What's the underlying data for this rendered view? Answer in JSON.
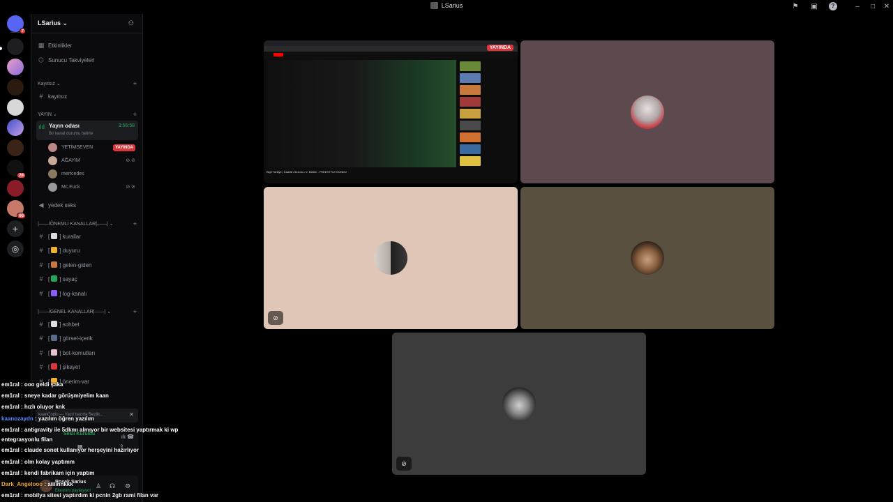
{
  "window": {
    "title": "LSarius"
  },
  "server": {
    "name": "LSarius",
    "name_with_chevron": "LSarius ⌄",
    "top_items": [
      {
        "label": "Etkinlikler"
      },
      {
        "label": "Sunucu Takviyeleri"
      }
    ],
    "categories": {
      "kayitsiz": "Kayıtsız ⌄",
      "yayin": "YAYIN ⌄",
      "onemli": "|——İÖNEMLİ KANALLAR|——| ⌄",
      "genel": "|——İGENEL KANALLAR|——| ⌄"
    },
    "kayitsiz_channel": "kayıtsız",
    "voice_channel": {
      "name": "Yayın odası",
      "status": "Bir kanal durumu belirle",
      "duration": "3:56:58",
      "users": [
        {
          "name": "YETİMSEVEN",
          "live": "YAYINDA"
        },
        {
          "name": "AĞAYIM"
        },
        {
          "name": "mertcedes"
        },
        {
          "name": "Mc.Fuck"
        }
      ]
    },
    "second_voice": "yedek seks",
    "onemli_channels": [
      {
        "label": "kurallar"
      },
      {
        "label": "duyuru"
      },
      {
        "label": "gelen-giden"
      },
      {
        "label": "sayaç"
      },
      {
        "label": "log-kanalı"
      }
    ],
    "genel_channels": [
      {
        "label": "sohbet"
      },
      {
        "label": "görsel-içerik"
      },
      {
        "label": "bot-komutları"
      },
      {
        "label": "şikayet"
      },
      {
        "label": "önerim-var"
      }
    ]
  },
  "rail_badges": {
    "first": "7",
    "second": "24",
    "third": "66"
  },
  "stage": {
    "live_label": "YAYINDA",
    "stream_video_title": "Bigli Türkiye | Kaantin Sezonu / 2. Bölüm : FREESTYLE GÜNDÜ"
  },
  "panel": {
    "voice_connected": "Sesli Kuruldu",
    "screen_share": "Ekranını paylaşıyor",
    "user": "Rosek Sarius",
    "dm_preview": "kaanCoplu — Yazıl hazırla Bezlik..."
  },
  "chat": [
    {
      "user": "em1ral",
      "text": " : ooo geldi şaka",
      "color": "#ffffff"
    },
    {
      "user": "em1ral",
      "text": " : sneye kadar görüşmiyelim kaan",
      "color": "#ffffff"
    },
    {
      "user": "em1ral",
      "text": " : hızlı oluyor knk",
      "color": "#ffffff"
    },
    {
      "user": "kaanozaydn",
      "text": " : yazılım öğren yazılım",
      "color": "#4f8bff"
    },
    {
      "user": "em1ral",
      "text": " : antigravity ile 5dkmı almıyor bir websitesi yaptırmak ki wp",
      "color": "#ffffff"
    },
    {
      "user": "",
      "text": "entegrasyonlu filan",
      "color": "#ffffff"
    },
    {
      "user": "em1ral",
      "text": " : claude sonet kullanıyor herşeyini hazırlıyor",
      "color": "#ffffff"
    },
    {
      "user": "em1ral",
      "text": " : olm kolay yaptımm",
      "color": "#ffffff"
    },
    {
      "user": "em1ral",
      "text": " : kendi fabrikam için yaptım",
      "color": "#ffffff"
    },
    {
      "user": "Dark_Angelooo",
      "text": " : aiiiinnkkk",
      "color": "#f0a830"
    },
    {
      "user": "em1ral",
      "text": " : mobilya sitesi yaptırdım ki pcnin 2gb rami filan var",
      "color": "#ffffff"
    }
  ],
  "colors": {
    "accent_green": "#23a55a",
    "live_red": "#da373c",
    "stage_bg": "#000000"
  }
}
